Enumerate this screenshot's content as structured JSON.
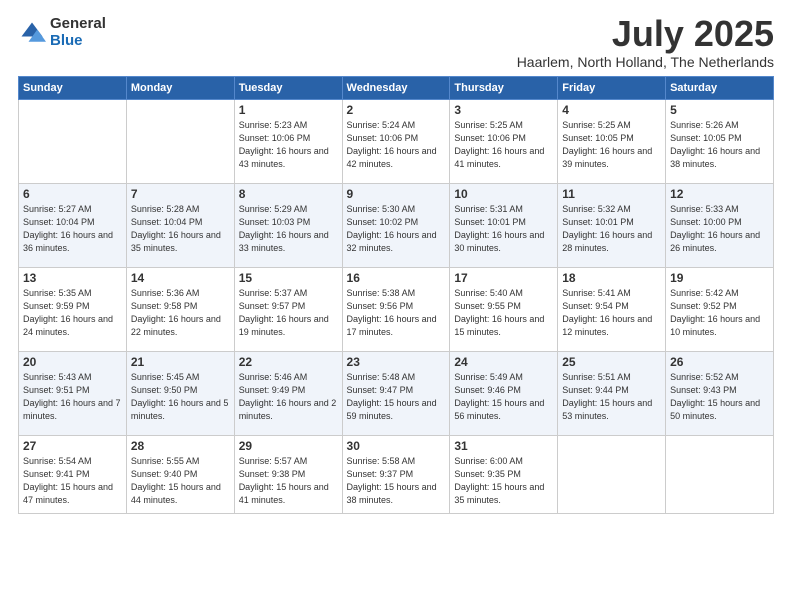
{
  "logo": {
    "general": "General",
    "blue": "Blue"
  },
  "title": "July 2025",
  "location": "Haarlem, North Holland, The Netherlands",
  "weekdays": [
    "Sunday",
    "Monday",
    "Tuesday",
    "Wednesday",
    "Thursday",
    "Friday",
    "Saturday"
  ],
  "weeks": [
    [
      {
        "day": "",
        "empty": true
      },
      {
        "day": "",
        "empty": true
      },
      {
        "day": "1",
        "sunrise": "5:23 AM",
        "sunset": "10:06 PM",
        "daylight": "16 hours and 43 minutes."
      },
      {
        "day": "2",
        "sunrise": "5:24 AM",
        "sunset": "10:06 PM",
        "daylight": "16 hours and 42 minutes."
      },
      {
        "day": "3",
        "sunrise": "5:25 AM",
        "sunset": "10:06 PM",
        "daylight": "16 hours and 41 minutes."
      },
      {
        "day": "4",
        "sunrise": "5:25 AM",
        "sunset": "10:05 PM",
        "daylight": "16 hours and 39 minutes."
      },
      {
        "day": "5",
        "sunrise": "5:26 AM",
        "sunset": "10:05 PM",
        "daylight": "16 hours and 38 minutes."
      }
    ],
    [
      {
        "day": "6",
        "sunrise": "5:27 AM",
        "sunset": "10:04 PM",
        "daylight": "16 hours and 36 minutes."
      },
      {
        "day": "7",
        "sunrise": "5:28 AM",
        "sunset": "10:04 PM",
        "daylight": "16 hours and 35 minutes."
      },
      {
        "day": "8",
        "sunrise": "5:29 AM",
        "sunset": "10:03 PM",
        "daylight": "16 hours and 33 minutes."
      },
      {
        "day": "9",
        "sunrise": "5:30 AM",
        "sunset": "10:02 PM",
        "daylight": "16 hours and 32 minutes."
      },
      {
        "day": "10",
        "sunrise": "5:31 AM",
        "sunset": "10:01 PM",
        "daylight": "16 hours and 30 minutes."
      },
      {
        "day": "11",
        "sunrise": "5:32 AM",
        "sunset": "10:01 PM",
        "daylight": "16 hours and 28 minutes."
      },
      {
        "day": "12",
        "sunrise": "5:33 AM",
        "sunset": "10:00 PM",
        "daylight": "16 hours and 26 minutes."
      }
    ],
    [
      {
        "day": "13",
        "sunrise": "5:35 AM",
        "sunset": "9:59 PM",
        "daylight": "16 hours and 24 minutes."
      },
      {
        "day": "14",
        "sunrise": "5:36 AM",
        "sunset": "9:58 PM",
        "daylight": "16 hours and 22 minutes."
      },
      {
        "day": "15",
        "sunrise": "5:37 AM",
        "sunset": "9:57 PM",
        "daylight": "16 hours and 19 minutes."
      },
      {
        "day": "16",
        "sunrise": "5:38 AM",
        "sunset": "9:56 PM",
        "daylight": "16 hours and 17 minutes."
      },
      {
        "day": "17",
        "sunrise": "5:40 AM",
        "sunset": "9:55 PM",
        "daylight": "16 hours and 15 minutes."
      },
      {
        "day": "18",
        "sunrise": "5:41 AM",
        "sunset": "9:54 PM",
        "daylight": "16 hours and 12 minutes."
      },
      {
        "day": "19",
        "sunrise": "5:42 AM",
        "sunset": "9:52 PM",
        "daylight": "16 hours and 10 minutes."
      }
    ],
    [
      {
        "day": "20",
        "sunrise": "5:43 AM",
        "sunset": "9:51 PM",
        "daylight": "16 hours and 7 minutes."
      },
      {
        "day": "21",
        "sunrise": "5:45 AM",
        "sunset": "9:50 PM",
        "daylight": "16 hours and 5 minutes."
      },
      {
        "day": "22",
        "sunrise": "5:46 AM",
        "sunset": "9:49 PM",
        "daylight": "16 hours and 2 minutes."
      },
      {
        "day": "23",
        "sunrise": "5:48 AM",
        "sunset": "9:47 PM",
        "daylight": "15 hours and 59 minutes."
      },
      {
        "day": "24",
        "sunrise": "5:49 AM",
        "sunset": "9:46 PM",
        "daylight": "15 hours and 56 minutes."
      },
      {
        "day": "25",
        "sunrise": "5:51 AM",
        "sunset": "9:44 PM",
        "daylight": "15 hours and 53 minutes."
      },
      {
        "day": "26",
        "sunrise": "5:52 AM",
        "sunset": "9:43 PM",
        "daylight": "15 hours and 50 minutes."
      }
    ],
    [
      {
        "day": "27",
        "sunrise": "5:54 AM",
        "sunset": "9:41 PM",
        "daylight": "15 hours and 47 minutes."
      },
      {
        "day": "28",
        "sunrise": "5:55 AM",
        "sunset": "9:40 PM",
        "daylight": "15 hours and 44 minutes."
      },
      {
        "day": "29",
        "sunrise": "5:57 AM",
        "sunset": "9:38 PM",
        "daylight": "15 hours and 41 minutes."
      },
      {
        "day": "30",
        "sunrise": "5:58 AM",
        "sunset": "9:37 PM",
        "daylight": "15 hours and 38 minutes."
      },
      {
        "day": "31",
        "sunrise": "6:00 AM",
        "sunset": "9:35 PM",
        "daylight": "15 hours and 35 minutes."
      },
      {
        "day": "",
        "empty": true
      },
      {
        "day": "",
        "empty": true
      }
    ]
  ]
}
